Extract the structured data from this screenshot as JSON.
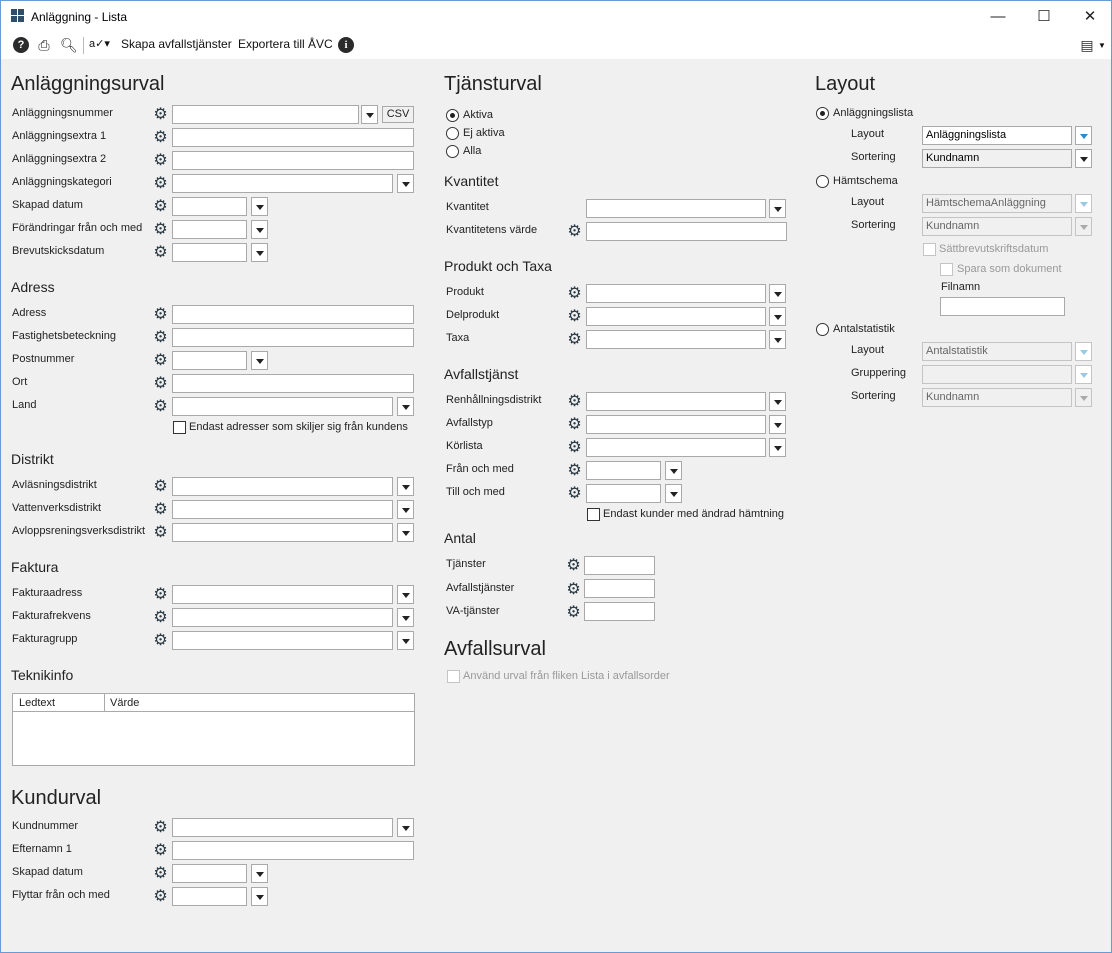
{
  "window": {
    "title": "Anläggning - Lista",
    "minimize": "—",
    "maximize": "☐",
    "close": "✕"
  },
  "toolbar": {
    "create": "Skapa avfallstjänster",
    "export": "Exportera till ÅVC",
    "signature": "a✓▾"
  },
  "s_anl": {
    "title": "Anläggningsurval",
    "nummer": "Anläggningsnummer",
    "csv": "CSV",
    "extra1": "Anläggningsextra 1",
    "extra2": "Anläggningsextra 2",
    "kategori": "Anläggningskategori",
    "skapad": "Skapad datum",
    "forandr": "Förändringar från och med",
    "brevut": "Brevutskicksdatum"
  },
  "s_adress": {
    "title": "Adress",
    "adress": "Adress",
    "fastighet": "Fastighetsbeteckning",
    "postnr": "Postnummer",
    "ort": "Ort",
    "land": "Land",
    "endast": "Endast adresser som skiljer sig från kundens"
  },
  "s_distrikt": {
    "title": "Distrikt",
    "avl": "Avläsningsdistrikt",
    "vatten": "Vattenverksdistrikt",
    "avlopp": "Avloppsreningsverksdistrikt"
  },
  "s_faktura": {
    "title": "Faktura",
    "adress": "Fakturaadress",
    "frekvens": "Fakturafrekvens",
    "grupp": "Fakturagrupp"
  },
  "s_teknik": {
    "title": "Teknikinfo",
    "col1": "Ledtext",
    "col2": "Värde"
  },
  "s_kund": {
    "title": "Kundurval",
    "nummer": "Kundnummer",
    "efternamn": "Efternamn 1",
    "skapad": "Skapad datum",
    "flyttar": "Flyttar från och med"
  },
  "s_tjanst": {
    "title": "Tjänsturval",
    "aktiva": "Aktiva",
    "ejaktiva": "Ej aktiva",
    "alla": "Alla"
  },
  "s_kvant": {
    "title": "Kvantitet",
    "kvantitet": "Kvantitet",
    "varde": "Kvantitetens värde"
  },
  "s_prod": {
    "title": "Produkt och Taxa",
    "produkt": "Produkt",
    "delprodukt": "Delprodukt",
    "taxa": "Taxa"
  },
  "s_avf": {
    "title": "Avfallstjänst",
    "renh": "Renhållningsdistrikt",
    "typ": "Avfallstyp",
    "korlista": "Körlista",
    "fran": "Från och med",
    "till": "Till och med",
    "endast": "Endast kunder med ändrad hämtning"
  },
  "s_antal": {
    "title": "Antal",
    "tjanster": "Tjänster",
    "avfall": "Avfallstjänster",
    "va": "VA-tjänster"
  },
  "s_avfurval": {
    "title": "Avfallsurval",
    "anvand": "Använd urval från fliken Lista i avfallsorder"
  },
  "s_layout": {
    "title": "Layout",
    "lista": {
      "label": "Anläggningslista",
      "layout_lbl": "Layout",
      "layout_val": "Anläggningslista",
      "sort_lbl": "Sortering",
      "sort_val": "Kundnamn"
    },
    "hamt": {
      "label": "Hämtschema",
      "layout_lbl": "Layout",
      "layout_val": "HämtschemaAnläggning",
      "sort_lbl": "Sortering",
      "sort_val": "Kundnamn",
      "satt": "Sättbrevutskriftsdatum",
      "spara": "Spara som dokument",
      "filnamn": "Filnamn"
    },
    "antal": {
      "label": "Antalstatistik",
      "layout_lbl": "Layout",
      "layout_val": "Antalstatistik",
      "grupp_lbl": "Gruppering",
      "sort_lbl": "Sortering",
      "sort_val": "Kundnamn"
    }
  }
}
